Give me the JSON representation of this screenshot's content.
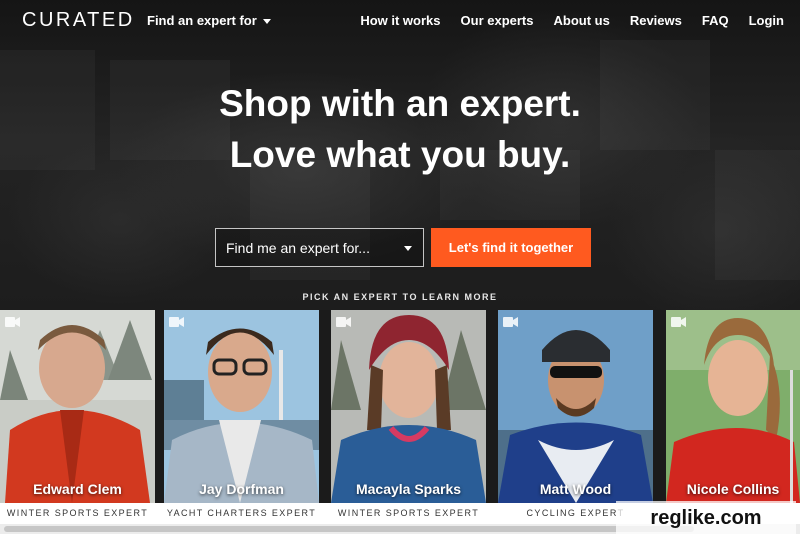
{
  "brand": {
    "logo": "CURATED"
  },
  "nav": {
    "find_menu_label": "Find an expert for",
    "links": [
      "How it works",
      "Our experts",
      "About us",
      "Reviews",
      "FAQ",
      "Login"
    ]
  },
  "hero": {
    "headline_line1": "Shop with an expert.",
    "headline_line2": "Love what you buy."
  },
  "search": {
    "select_value": "Find me an expert for...",
    "cta_label": "Let's find it together",
    "pick_label": "PICK AN EXPERT TO LEARN MORE"
  },
  "experts": [
    {
      "name": "Edward Clem",
      "role": "WINTER SPORTS EXPERT"
    },
    {
      "name": "Jay Dorfman",
      "role": "YACHT CHARTERS EXPERT"
    },
    {
      "name": "Macayla Sparks",
      "role": "WINTER SPORTS EXPERT"
    },
    {
      "name": "Matt Wood",
      "role": "CYCLING EXPERT"
    },
    {
      "name": "Nicole Collins",
      "role": ""
    }
  ],
  "watermark": "reglike.com",
  "colors": {
    "accent": "#ff5a1f",
    "nav_text": "#ffffff",
    "hero_bg": "#1b1b1b"
  },
  "icons": {
    "video": "video-camera-icon",
    "dropdown": "chevron-down-icon"
  }
}
